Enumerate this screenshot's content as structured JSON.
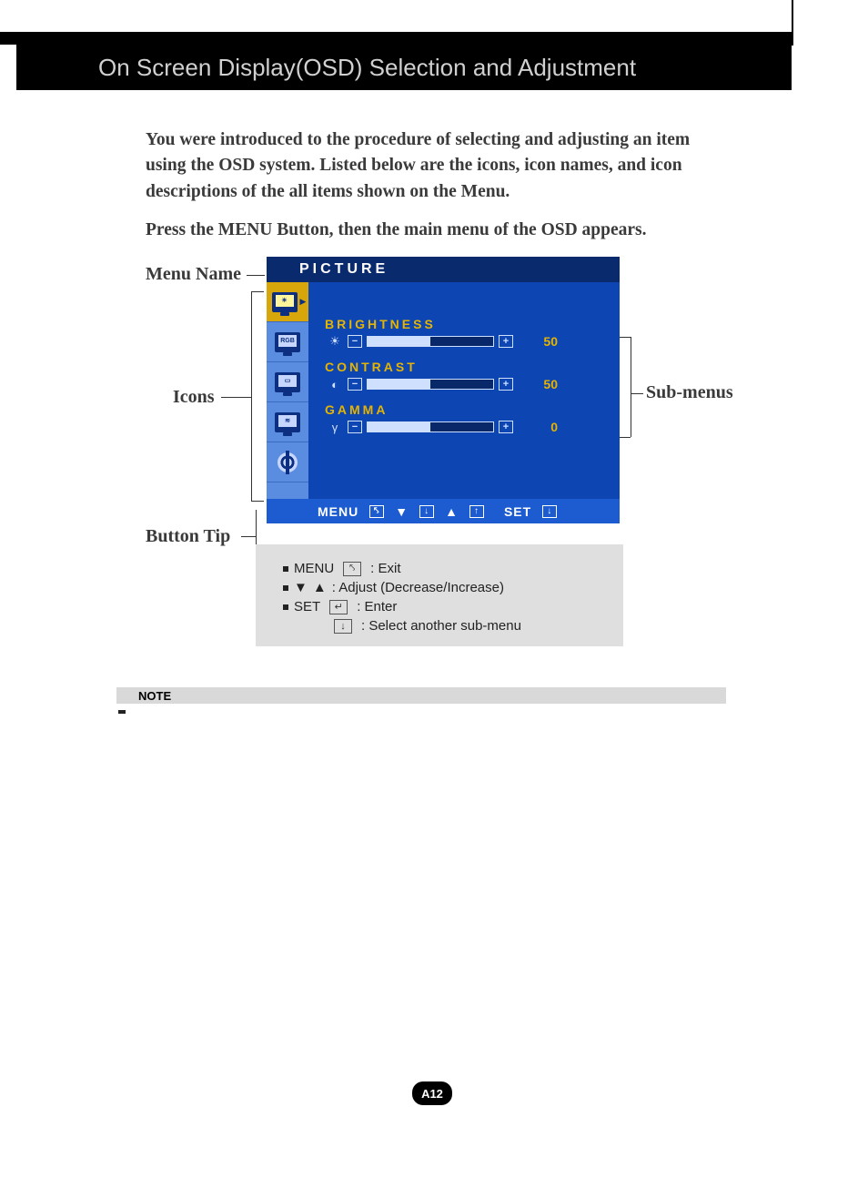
{
  "header": {
    "title": "On Screen Display(OSD) Selection and Adjustment"
  },
  "intro": "You were introduced to the procedure of selecting and adjusting an item using the OSD system.  Listed below are the icons, icon names, and icon descriptions of the all items shown on the Menu.",
  "press": "Press the MENU Button, then the main menu of the OSD appears.",
  "labels": {
    "menu_name": "Menu Name",
    "icons": "Icons",
    "submenus": "Sub-menus",
    "button_tip": "Button Tip"
  },
  "osd": {
    "title": "PICTURE",
    "icons": [
      "sun-icon",
      "rgb-icon",
      "screen-icon",
      "wave-icon",
      "gear-icon"
    ],
    "items": [
      {
        "name": "BRIGHTNESS",
        "symbol": "☀",
        "value": "50",
        "percent": 50
      },
      {
        "name": "CONTRAST",
        "symbol": "◐",
        "value": "50",
        "percent": 50
      },
      {
        "name": "GAMMA",
        "symbol": "γ",
        "value": "0",
        "percent": 50
      }
    ],
    "footer": {
      "menu": "MENU",
      "set": "SET"
    }
  },
  "tips": {
    "line1_pre": "MENU",
    "line1_post": ": Exit",
    "line2": ": Adjust (Decrease/Increase)",
    "line3_pre": "SET",
    "line3_post": ": Enter",
    "line4": ": Select another sub-menu"
  },
  "note_label": "NOTE",
  "page_number": "A12"
}
